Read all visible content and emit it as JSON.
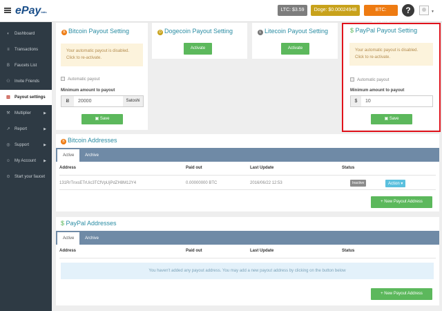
{
  "header": {
    "logo": "ePay",
    "logo_sub": "bids",
    "ltc": "LTC: $3.59",
    "doge": "Doge: $0.00024948",
    "btc": "BTC: $571.78",
    "help": "?"
  },
  "sidebar": {
    "items": [
      {
        "label": "Dashboard",
        "icon": "◐"
      },
      {
        "label": "Transactions",
        "icon": "≡"
      },
      {
        "label": "Faucets List",
        "icon": "B"
      },
      {
        "label": "Invite Friends",
        "icon": "⚇"
      },
      {
        "label": "Payout settings",
        "icon": "▥"
      },
      {
        "label": "Multiplier",
        "icon": "⚒"
      },
      {
        "label": "Report",
        "icon": "↗"
      },
      {
        "label": "Support",
        "icon": "◎"
      },
      {
        "label": "My Account",
        "icon": "☺"
      },
      {
        "label": "Start your faucet",
        "icon": "⊙"
      }
    ],
    "arrow": "▶"
  },
  "bitcoin_settings": {
    "title": "Bitcoin Payout Setting",
    "alert_line1": "Your automatic payout is disabled.",
    "alert_line2": "Click to re-activate.",
    "auto_label": "Automatic payout",
    "min_label": "Minimum amount to payout",
    "currency": "Ƀ",
    "value": "20000",
    "unit": "Satoshi",
    "save": "Save"
  },
  "dogecoin_settings": {
    "title": "Dogecoin Payout Setting",
    "activate": "Activate"
  },
  "litecoin_settings": {
    "title": "Litecoin Payout Setting",
    "activate": "Activate"
  },
  "paypal_settings": {
    "title": "PayPal Payout Setting",
    "alert_line1": "Your automatic payout is disabled.",
    "alert_line2": "Click to re-activate.",
    "auto_label": "Automatic payout",
    "min_label": "Minimum amount to payout",
    "currency": "$",
    "value": "10",
    "save": "Save"
  },
  "bitcoin_addresses": {
    "title": "Bitcoin Addresses",
    "tabs": [
      "Active",
      "Archive"
    ],
    "columns": [
      "Address",
      "Paid out",
      "Last Update",
      "Status"
    ],
    "rows": [
      {
        "address": "131RrTnxsETrUic3TCfVpUjPdZH8M12Y4",
        "paid": "0.00000000 BTC",
        "updated": "2016/06/22 12:53",
        "status": "Inactive",
        "action": "Action ▾"
      }
    ],
    "new_button": "+ New Payout Address"
  },
  "paypal_addresses": {
    "title": "PayPal Addresses",
    "tabs": [
      "Active",
      "Archive"
    ],
    "columns": [
      "Address",
      "Paid out",
      "Last Update",
      "Status"
    ],
    "empty": "You haven't added any payout address. You may add a new payout address by clicking on the button below",
    "new_button": "+ New Payout Address"
  },
  "colors": {
    "accent": "#2a8ca3",
    "btc": "#ee7b12",
    "doge": "#c8a21b",
    "ltc": "#7d7d7d",
    "paypal": "#5cb85c",
    "highlight": "#e0121b"
  }
}
